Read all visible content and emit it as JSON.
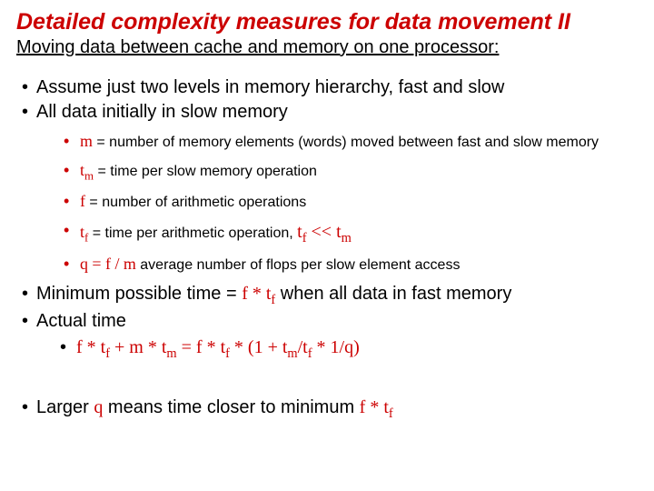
{
  "title": "Detailed complexity measures for data movement II",
  "subtitle": "Moving data between cache and memory on one processor:",
  "b1": "Assume just two levels in memory hierarchy, fast and slow",
  "b2": "All data initially in slow memory",
  "sb1_pre": "m",
  "sb1_post": " = number of memory elements (words) moved between fast and slow memory",
  "sb2_t": "t",
  "sb2_sub": "m",
  "sb2_post": " = time per slow memory operation",
  "sb3_pre": "f",
  "sb3_post": " = number of arithmetic operations",
  "sb4_t": "t",
  "sb4_sub": "f",
  "sb4_mid": " = time per arithmetic operation,  ",
  "sb4_tf_t": "t",
  "sb4_tf_s": "f",
  "sb4_op": " << ",
  "sb4_tm_t": "t",
  "sb4_tm_s": "m",
  "sb5_q": "q = f / m",
  "sb5_post": "   average number of flops per slow element access",
  "b3_pre": "Minimum possible time = ",
  "b3_eq": "f * t",
  "b3_sub": "f",
  "b3_post": "  when all data in fast memory",
  "b4": "Actual time",
  "b4eq_1": "f * t",
  "b4eq_1s": "f",
  "b4eq_2": "  +  m * t",
  "b4eq_2s": "m",
  "b4eq_3": "   =   f * t",
  "b4eq_3s": "f",
  "b4eq_4": " * (1 + t",
  "b4eq_4s": "m",
  "b4eq_5": "/t",
  "b4eq_5s": "f",
  "b4eq_6": "  * 1/q)",
  "b5_pre": "Larger ",
  "b5_q": "q",
  "b5_mid": " means time closer to minimum ",
  "b5_eq": "f * t",
  "b5_sub": "f"
}
